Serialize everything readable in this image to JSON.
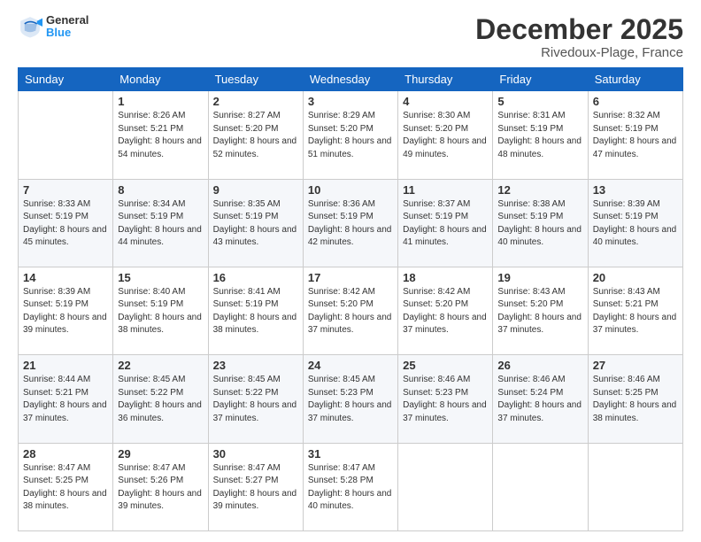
{
  "header": {
    "logo": {
      "general": "General",
      "blue": "Blue"
    },
    "title": "December 2025",
    "subtitle": "Rivedoux-Plage, France"
  },
  "weekdays": [
    "Sunday",
    "Monday",
    "Tuesday",
    "Wednesday",
    "Thursday",
    "Friday",
    "Saturday"
  ],
  "weeks": [
    [
      {
        "day": "",
        "info": ""
      },
      {
        "day": "1",
        "info": "Sunrise: 8:26 AM\nSunset: 5:21 PM\nDaylight: 8 hours\nand 54 minutes."
      },
      {
        "day": "2",
        "info": "Sunrise: 8:27 AM\nSunset: 5:20 PM\nDaylight: 8 hours\nand 52 minutes."
      },
      {
        "day": "3",
        "info": "Sunrise: 8:29 AM\nSunset: 5:20 PM\nDaylight: 8 hours\nand 51 minutes."
      },
      {
        "day": "4",
        "info": "Sunrise: 8:30 AM\nSunset: 5:20 PM\nDaylight: 8 hours\nand 49 minutes."
      },
      {
        "day": "5",
        "info": "Sunrise: 8:31 AM\nSunset: 5:19 PM\nDaylight: 8 hours\nand 48 minutes."
      },
      {
        "day": "6",
        "info": "Sunrise: 8:32 AM\nSunset: 5:19 PM\nDaylight: 8 hours\nand 47 minutes."
      }
    ],
    [
      {
        "day": "7",
        "info": "Sunrise: 8:33 AM\nSunset: 5:19 PM\nDaylight: 8 hours\nand 45 minutes."
      },
      {
        "day": "8",
        "info": "Sunrise: 8:34 AM\nSunset: 5:19 PM\nDaylight: 8 hours\nand 44 minutes."
      },
      {
        "day": "9",
        "info": "Sunrise: 8:35 AM\nSunset: 5:19 PM\nDaylight: 8 hours\nand 43 minutes."
      },
      {
        "day": "10",
        "info": "Sunrise: 8:36 AM\nSunset: 5:19 PM\nDaylight: 8 hours\nand 42 minutes."
      },
      {
        "day": "11",
        "info": "Sunrise: 8:37 AM\nSunset: 5:19 PM\nDaylight: 8 hours\nand 41 minutes."
      },
      {
        "day": "12",
        "info": "Sunrise: 8:38 AM\nSunset: 5:19 PM\nDaylight: 8 hours\nand 40 minutes."
      },
      {
        "day": "13",
        "info": "Sunrise: 8:39 AM\nSunset: 5:19 PM\nDaylight: 8 hours\nand 40 minutes."
      }
    ],
    [
      {
        "day": "14",
        "info": "Sunrise: 8:39 AM\nSunset: 5:19 PM\nDaylight: 8 hours\nand 39 minutes."
      },
      {
        "day": "15",
        "info": "Sunrise: 8:40 AM\nSunset: 5:19 PM\nDaylight: 8 hours\nand 38 minutes."
      },
      {
        "day": "16",
        "info": "Sunrise: 8:41 AM\nSunset: 5:19 PM\nDaylight: 8 hours\nand 38 minutes."
      },
      {
        "day": "17",
        "info": "Sunrise: 8:42 AM\nSunset: 5:20 PM\nDaylight: 8 hours\nand 37 minutes."
      },
      {
        "day": "18",
        "info": "Sunrise: 8:42 AM\nSunset: 5:20 PM\nDaylight: 8 hours\nand 37 minutes."
      },
      {
        "day": "19",
        "info": "Sunrise: 8:43 AM\nSunset: 5:20 PM\nDaylight: 8 hours\nand 37 minutes."
      },
      {
        "day": "20",
        "info": "Sunrise: 8:43 AM\nSunset: 5:21 PM\nDaylight: 8 hours\nand 37 minutes."
      }
    ],
    [
      {
        "day": "21",
        "info": "Sunrise: 8:44 AM\nSunset: 5:21 PM\nDaylight: 8 hours\nand 37 minutes."
      },
      {
        "day": "22",
        "info": "Sunrise: 8:45 AM\nSunset: 5:22 PM\nDaylight: 8 hours\nand 36 minutes."
      },
      {
        "day": "23",
        "info": "Sunrise: 8:45 AM\nSunset: 5:22 PM\nDaylight: 8 hours\nand 37 minutes."
      },
      {
        "day": "24",
        "info": "Sunrise: 8:45 AM\nSunset: 5:23 PM\nDaylight: 8 hours\nand 37 minutes."
      },
      {
        "day": "25",
        "info": "Sunrise: 8:46 AM\nSunset: 5:23 PM\nDaylight: 8 hours\nand 37 minutes."
      },
      {
        "day": "26",
        "info": "Sunrise: 8:46 AM\nSunset: 5:24 PM\nDaylight: 8 hours\nand 37 minutes."
      },
      {
        "day": "27",
        "info": "Sunrise: 8:46 AM\nSunset: 5:25 PM\nDaylight: 8 hours\nand 38 minutes."
      }
    ],
    [
      {
        "day": "28",
        "info": "Sunrise: 8:47 AM\nSunset: 5:25 PM\nDaylight: 8 hours\nand 38 minutes."
      },
      {
        "day": "29",
        "info": "Sunrise: 8:47 AM\nSunset: 5:26 PM\nDaylight: 8 hours\nand 39 minutes."
      },
      {
        "day": "30",
        "info": "Sunrise: 8:47 AM\nSunset: 5:27 PM\nDaylight: 8 hours\nand 39 minutes."
      },
      {
        "day": "31",
        "info": "Sunrise: 8:47 AM\nSunset: 5:28 PM\nDaylight: 8 hours\nand 40 minutes."
      },
      {
        "day": "",
        "info": ""
      },
      {
        "day": "",
        "info": ""
      },
      {
        "day": "",
        "info": ""
      }
    ]
  ]
}
